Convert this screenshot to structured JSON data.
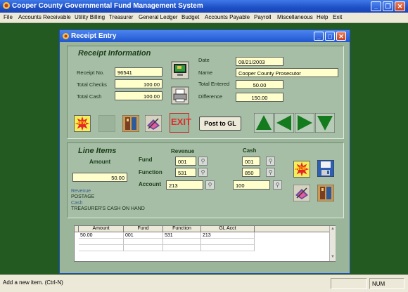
{
  "app": {
    "title": "Cooper County Governmental Fund Management System",
    "menu": [
      "File",
      "Accounts Receivable",
      "Utility Billing",
      "Treasurer",
      "General Ledger",
      "Budget",
      "Accounts Payable",
      "Payroll",
      "Miscellaneous",
      "Help",
      "Exit"
    ]
  },
  "child": {
    "title": "Receipt Entry"
  },
  "receipt": {
    "heading": "Receipt Information",
    "receipt_no_label": "Receipt No.",
    "receipt_no": "96541",
    "total_checks_label": "Total Checks",
    "total_checks": "100.00",
    "total_cash_label": "Total Cash",
    "total_cash": "100.00",
    "date_label": "Date",
    "date": "08/21/2003",
    "name_label": "Name",
    "name": "Cooper County Prosecutor",
    "total_entered_label": "Total Entered",
    "total_entered": "50.00",
    "difference_label": "Difference",
    "difference": "150.00"
  },
  "toolbar": {
    "new_label": "NEW",
    "exit_label": "EXIT",
    "post_label": "Post to GL"
  },
  "line_items": {
    "heading": "Line Items",
    "amount_label": "Amount",
    "amount": "50.00",
    "revenue_label": "Revenue",
    "cash_label": "Cash",
    "fund_label": "Fund",
    "function_label": "Function",
    "account_label": "Account",
    "rev_fund": "001",
    "rev_function": "531",
    "rev_account": "213",
    "cash_fund": "001",
    "cash_function": "850",
    "cash_account": "100",
    "rev_desc_label": "Revenue",
    "rev_desc": "POSTAGE",
    "cash_desc_label": "Cash",
    "cash_desc": "TREASURER'S CASH ON HAND",
    "new_label": "NEW"
  },
  "grid": {
    "columns": [
      "Amount",
      "Fund",
      "Function",
      "GL Acct"
    ],
    "rows": [
      [
        "50.00",
        "001",
        "531",
        "213"
      ]
    ]
  },
  "status": {
    "message": "Add a new item. (Ctrl-N)",
    "indicator": "NUM"
  },
  "colors": {
    "desktop": "#235a22",
    "form_bg": "#9ab59a",
    "field_bg": "#ffffcc",
    "titlebar": "#1d4fc5"
  }
}
